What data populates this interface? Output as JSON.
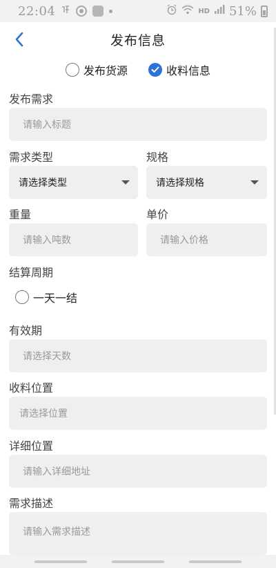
{
  "status": {
    "time": "22:04",
    "hd": "HD",
    "battery": "51%"
  },
  "header": {
    "title": "发布信息"
  },
  "type_toggle": {
    "options": [
      {
        "label": "发布货源",
        "selected": false
      },
      {
        "label": "收料信息",
        "selected": true
      }
    ]
  },
  "form": {
    "demand": {
      "label": "发布需求",
      "placeholder": "请输入标题"
    },
    "type": {
      "label": "需求类型",
      "value": "请选择类型"
    },
    "spec": {
      "label": "规格",
      "value": "请选择规格"
    },
    "weight": {
      "label": "重量",
      "placeholder": "请输入吨数"
    },
    "price": {
      "label": "单价",
      "placeholder": "请输入价格"
    },
    "cycle": {
      "label": "结算周期",
      "option": "一天一结"
    },
    "validity": {
      "label": "有效期",
      "placeholder": "请选择天数"
    },
    "location": {
      "label": "收料位置",
      "placeholder": "请选择位置"
    },
    "address": {
      "label": "详细位置",
      "placeholder": "请输入详细地址"
    },
    "description": {
      "label": "需求描述",
      "placeholder": "请输入需求描述"
    }
  },
  "colors": {
    "accent": "#2d72d9",
    "field_bg": "#efefef"
  }
}
